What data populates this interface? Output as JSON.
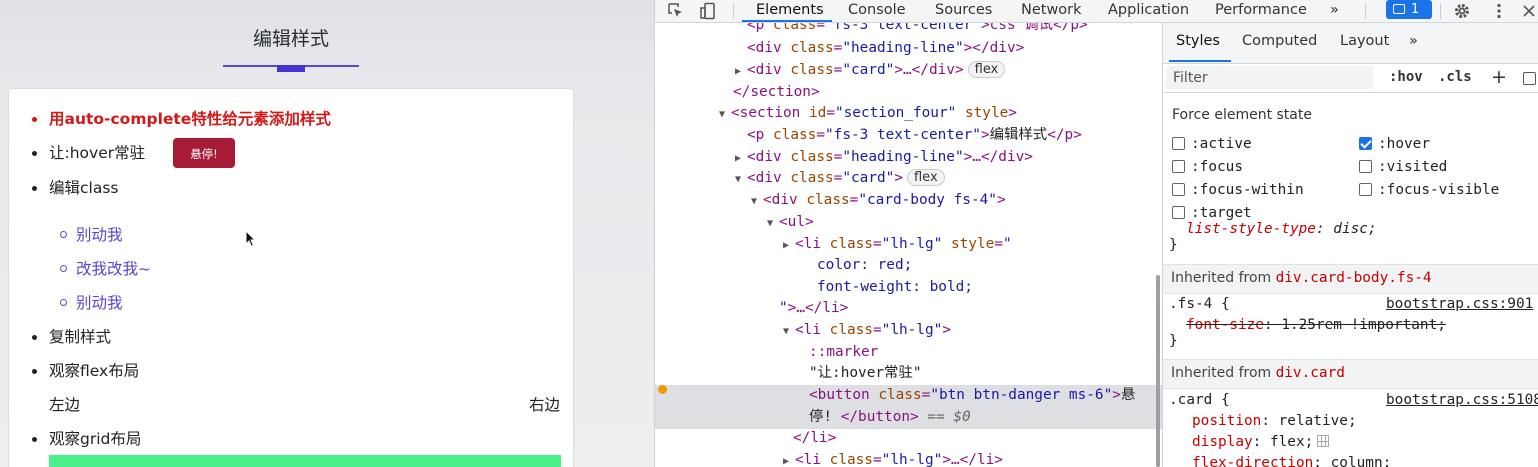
{
  "page": {
    "section_title": "编辑样式",
    "items": [
      {
        "text": "用auto-complete特性给元素添加样式"
      },
      {
        "text": "让:hover常驻",
        "button": "悬停!"
      },
      {
        "text": "编辑class"
      },
      {
        "text": "复制样式"
      },
      {
        "text": "观察flex布局"
      },
      {
        "text": "观察grid布局"
      }
    ],
    "sub_items": [
      "别动我",
      "改我改我~",
      "别动我"
    ],
    "flex_left": "左边",
    "flex_right": "右边",
    "colors": {
      "red_text": "#d21a1a",
      "danger_button": "#a81b36",
      "link_purple": "#5746d2",
      "heading_line": "#4634d0",
      "grid_bar": "#4cf08a"
    }
  },
  "devtools": {
    "tabs": [
      "Elements",
      "Console",
      "Sources",
      "Network",
      "Application",
      "Performance"
    ],
    "active_tab": "Elements",
    "more_tabs": "»",
    "issues_count": "1",
    "toolbar_icons": [
      "inspect-icon",
      "device-toggle-icon",
      "gear-icon",
      "kebab-menu-icon",
      "close-icon"
    ],
    "elements": {
      "l0": {
        "t1": "<p ",
        "a1": "class",
        "v1": "\"fs-3 text-center\"",
        "t2": ">css 调试</p>"
      },
      "l1": {
        "t1": "<div ",
        "a1": "class",
        "v1": "\"heading-line\"",
        "t2": "></div>"
      },
      "l2": {
        "t1": "<div ",
        "a1": "class",
        "v1": "\"card\"",
        "t2": ">…</div>",
        "badge": "flex"
      },
      "l3": {
        "t1": "</section>"
      },
      "l4": {
        "t1": "<section ",
        "a1": "id",
        "v1": "\"section_four\"",
        "a2": "style",
        "t2": ">"
      },
      "l5": {
        "t1": "<p ",
        "a1": "class",
        "v1": "\"fs-3 text-center\"",
        "t2": ">",
        "text": "编辑样式",
        "t3": "</p>"
      },
      "l6": {
        "t1": "<div ",
        "a1": "class",
        "v1": "\"heading-line\"",
        "t2": ">…</div>"
      },
      "l7": {
        "t1": "<div ",
        "a1": "class",
        "v1": "\"card\"",
        "t2": ">",
        "badge": "flex"
      },
      "l8": {
        "t1": "<div ",
        "a1": "class",
        "v1": "\"card-body fs-4\"",
        "t2": ">"
      },
      "l9": {
        "t1": "<ul>"
      },
      "l10": {
        "t1": "<li ",
        "a1": "class",
        "v1": "\"lh-lg\"",
        "a2": "style",
        "v2": "\""
      },
      "l11": {
        "text": "color: red;"
      },
      "l12": {
        "text": "font-weight: bold;"
      },
      "l13": {
        "v1": "\"",
        "t1": ">…</li>"
      },
      "l14": {
        "t1": "<li ",
        "a1": "class",
        "v1": "\"lh-lg\"",
        "t2": ">"
      },
      "l15": {
        "pseudo": "::marker"
      },
      "l16": {
        "text": "\"让:hover常驻\""
      },
      "l17": {
        "t1": "<button ",
        "a1": "class",
        "v1": "\"btn btn-danger ms-6\"",
        "t2": ">",
        "text": "悬"
      },
      "l18": {
        "text": "停! ",
        "t1": "</button>",
        "eq": " == $0"
      },
      "l19": {
        "t1": "</li>"
      },
      "l20": {
        "t1": "<li ",
        "a1": "class",
        "v1": "\"lh-lg\"",
        "t2": ">…</li>"
      }
    },
    "styles": {
      "subtabs": [
        "Styles",
        "Computed",
        "Layout",
        "»"
      ],
      "active_subtab": "Styles",
      "filter_placeholder": "Filter",
      "hov": ":hov",
      "cls": ".cls",
      "plus": "+",
      "force_state_title": "Force element state",
      "states": [
        {
          "label": ":active",
          "checked": false
        },
        {
          "label": ":hover",
          "checked": true
        },
        {
          "label": ":focus",
          "checked": false
        },
        {
          "label": ":visited",
          "checked": false
        },
        {
          "label": ":focus-within",
          "checked": false
        },
        {
          "label": ":focus-visible",
          "checked": false
        },
        {
          "label": ":target",
          "checked": false
        }
      ],
      "rule0": {
        "prop": "list-style-type",
        "val": "disc;",
        "close": "}"
      },
      "inherited1": {
        "label": "Inherited from ",
        "from": "div.card-body.fs-4"
      },
      "rule1": {
        "selector": ".fs-4 {",
        "source": "bootstrap.css:901",
        "prop": "font-size",
        "val": "1.25rem !important;",
        "close": "}"
      },
      "inherited2": {
        "label": "Inherited from ",
        "from": "div.card"
      },
      "rule2": {
        "selector": ".card {",
        "source": "bootstrap.css:5108",
        "props": [
          {
            "prop": "position",
            "val": "relative;"
          },
          {
            "prop": "display",
            "val": "flex;"
          },
          {
            "prop": "flex-direction",
            "val": "column;"
          }
        ]
      }
    }
  }
}
